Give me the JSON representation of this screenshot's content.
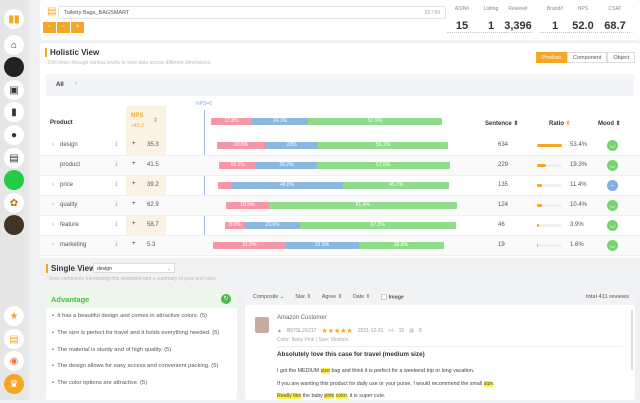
{
  "header": {
    "title_value": "Toiletry Bags_BAGSMART",
    "char_count": "22 / 50",
    "buttons": [
      "save-icon",
      "copy-icon",
      "close-icon"
    ],
    "stats": [
      {
        "label": "ASIN#",
        "value": "15"
      },
      {
        "label": "Listing",
        "value": "1"
      },
      {
        "label": "Review#",
        "value": "3,396"
      },
      {
        "label": "Brand#",
        "value": "1"
      },
      {
        "label": "NPS",
        "value": "52.0"
      },
      {
        "label": "CSAT",
        "value": "68.7"
      }
    ]
  },
  "holistic": {
    "title": "Holistic View",
    "subtitle": "Drill down through various levels to view data across different dimensions.",
    "tabs": [
      {
        "label": "Product",
        "active": true
      },
      {
        "label": "Component"
      },
      {
        "label": "Object"
      }
    ],
    "breadcrumb": "All",
    "nps_zero": "NPS=0",
    "columns": {
      "product": "Product",
      "nps": "NPS",
      "nps_sub": "+40.3",
      "sentence": "Sentence",
      "ratio": "Ratio",
      "mood": "Mood"
    },
    "total_bar": [
      "17.8%",
      "24.3%",
      "57.9%"
    ],
    "rows": [
      {
        "name": "design",
        "expand": true,
        "nps": "35.3",
        "bar": [
          20.8,
          23,
          56.1
        ],
        "labels": [
          "20.8%",
          "23%",
          "56.1%"
        ],
        "sentence": "634",
        "ratio": 53.4,
        "ratio_label": "53.4%",
        "mood": "happy"
      },
      {
        "name": "product",
        "expand": false,
        "nps": "41.5",
        "bar": [
          16.1,
          26.2,
          57.6
        ],
        "labels": [
          "16.1%",
          "26.2%",
          "57.6%"
        ],
        "sentence": "229",
        "ratio": 19.3,
        "ratio_label": "19.3%",
        "mood": "happy"
      },
      {
        "name": "price",
        "expand": true,
        "nps": "39.2",
        "bar": [
          5.5,
          48.8,
          45.7
        ],
        "labels": [
          "",
          "48.8%",
          "45.7%"
        ],
        "sentence": "135",
        "ratio": 11.4,
        "ratio_label": "11.4%",
        "mood": "neutral"
      },
      {
        "name": "quality",
        "expand": true,
        "nps": "62.9",
        "bar": [
          18.5,
          0,
          81.4
        ],
        "labels": [
          "18.5%",
          "",
          "81.4%"
        ],
        "sentence": "124",
        "ratio": 10.4,
        "ratio_label": "10.4%",
        "mood": "happy"
      },
      {
        "name": "feature",
        "expand": true,
        "nps": "58.7",
        "bar": [
          8.6,
          23.9,
          67.3
        ],
        "labels": [
          "8.6%",
          "23.9%",
          "67.3%"
        ],
        "sentence": "46",
        "ratio": 3.9,
        "ratio_label": "3.9%",
        "mood": "happy"
      },
      {
        "name": "marketing",
        "expand": true,
        "nps": "5.3",
        "bar": [
          31.5,
          31.5,
          36.8
        ],
        "labels": [
          "31.5%",
          "31.5%",
          "36.8%"
        ],
        "sentence": "19",
        "ratio": 1.6,
        "ratio_label": "1.6%",
        "mood": "happy"
      }
    ]
  },
  "single": {
    "title": "Single View",
    "select": "design",
    "subtitle": "View comments mentioning this viewpoint and a summary of pros and cons.",
    "advantage_title": "Advantage",
    "advantages": [
      "It has a beautiful design and comes in attractive colors. (5)",
      "The size is perfect for travel and it holds everything needed. (5)",
      "The material is sturdy and of high quality. (5)",
      "The design allows for easy access and convenient packing. (5)",
      "The color options are attractive. (5)"
    ],
    "filters": [
      "Composite",
      "Star",
      "Agree",
      "Date"
    ],
    "image_label": "Image",
    "total": "total 411 reviews",
    "review": {
      "author": "Amazon Customer",
      "asin": "B07SL2X217",
      "stars": "★★★★★",
      "date": "2021-12-31",
      "likes": "15",
      "comments": "5",
      "variant": "Color: Baby Pink | Size: Medium",
      "title": "Absolutely love this case for travel (medium size)",
      "l1a": "I got the MEDIUM ",
      "l1h": "size",
      "l1b": " bag and think it is perfect for a weekend trip or long vacation.",
      "l2a": "If you are wanting this product for daily use or your purse, I would recommend the small ",
      "l2h": "size",
      "l2b": ".",
      "l3h1": "Really like",
      "l3a": " the baby ",
      "l3h2": "pink",
      "l3b": " ",
      "l3h3": "color",
      "l3c": ", it is super cute."
    }
  },
  "colors": {
    "accent": "#f5a623",
    "negative": "#f597a8",
    "neutral": "#8cb8df",
    "positive": "#90dc8a"
  }
}
